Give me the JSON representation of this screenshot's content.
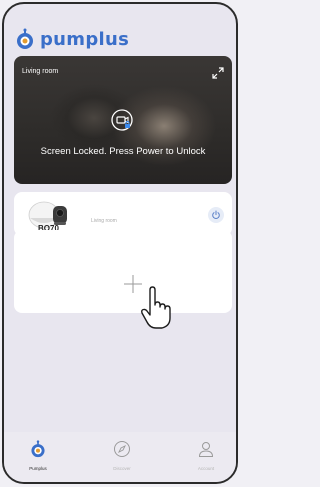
{
  "app": {
    "name": "pumplus"
  },
  "camera": {
    "room": "Living room",
    "lock_message": "Screen Locked. Press Power to Unlock"
  },
  "device": {
    "name": "BQ70",
    "room": "Living room"
  },
  "nav": [
    {
      "label": "Pumplus",
      "icon": "pumplus-icon",
      "active": true
    },
    {
      "label": "Discover",
      "icon": "compass-icon",
      "active": false
    },
    {
      "label": "Account",
      "icon": "person-icon",
      "active": false
    }
  ],
  "colors": {
    "brand": "#3a6fc9",
    "background": "#e8e6ef",
    "card": "#ffffff"
  }
}
